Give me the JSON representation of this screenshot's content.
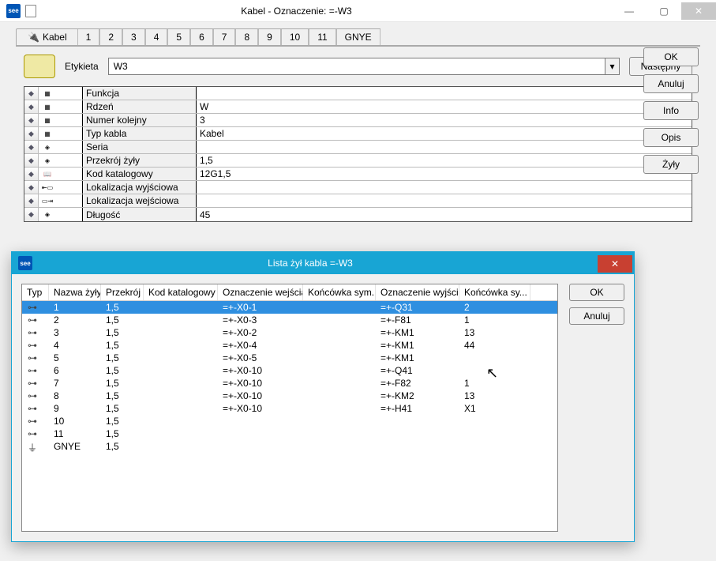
{
  "outer": {
    "title": "Kabel - Oznaczenie: =-W3",
    "tabs": {
      "main": "Kabel",
      "subs": [
        "1",
        "2",
        "3",
        "4",
        "5",
        "6",
        "7",
        "8",
        "9",
        "10",
        "11",
        "GNYE"
      ]
    },
    "etykieta_label": "Etykieta",
    "etykieta_value": "W3",
    "nastepny": "Następny",
    "buttons": {
      "ok": "OK",
      "anuluj": "Anuluj",
      "info": "Info",
      "opis": "Opis",
      "zyly": "Żyły"
    },
    "props": [
      {
        "icon": "chip",
        "label": "Funkcja",
        "value": ""
      },
      {
        "icon": "chip",
        "label": "Rdzeń",
        "value": "W"
      },
      {
        "icon": "chip",
        "label": "Numer kolejny",
        "value": "3"
      },
      {
        "icon": "chip",
        "label": "Typ kabla",
        "value": "Kabel"
      },
      {
        "icon": "dot",
        "label": "Seria",
        "value": ""
      },
      {
        "icon": "dot",
        "label": "Przekrój żyły",
        "value": "1,5"
      },
      {
        "icon": "book",
        "label": "Kod katalogowy",
        "value": "12G1,5"
      },
      {
        "icon": "locL",
        "label": "Lokalizacja wyjściowa",
        "value": ""
      },
      {
        "icon": "locR",
        "label": "Lokalizacja wejściowa",
        "value": ""
      },
      {
        "icon": "dot",
        "label": "Długość",
        "value": "45"
      }
    ]
  },
  "inner": {
    "title": "Lista żył kabla =-W3",
    "buttons": {
      "ok": "OK",
      "anuluj": "Anuluj"
    },
    "headers": [
      "Typ",
      "Nazwa żyły",
      "Przekrój",
      "Kod katalogowy",
      "Oznaczenie wejścia",
      "Końcówka sym...",
      "Oznaczenie wyjścia",
      "Końcówka sy..."
    ],
    "rows": [
      {
        "type": "wire",
        "nazwa": "1",
        "przek": "1,5",
        "kod": "",
        "owe": "=+-X0-1",
        "ks1": "",
        "owy": "=+-Q31",
        "ks2": "2",
        "selected": true
      },
      {
        "type": "wire",
        "nazwa": "2",
        "przek": "1,5",
        "kod": "",
        "owe": "=+-X0-3",
        "ks1": "",
        "owy": "=+-F81",
        "ks2": "1"
      },
      {
        "type": "wire",
        "nazwa": "3",
        "przek": "1,5",
        "kod": "",
        "owe": "=+-X0-2",
        "ks1": "",
        "owy": "=+-KM1",
        "ks2": "13"
      },
      {
        "type": "wire",
        "nazwa": "4",
        "przek": "1,5",
        "kod": "",
        "owe": "=+-X0-4",
        "ks1": "",
        "owy": "=+-KM1",
        "ks2": "44"
      },
      {
        "type": "wire",
        "nazwa": "5",
        "przek": "1,5",
        "kod": "",
        "owe": "=+-X0-5",
        "ks1": "",
        "owy": "=+-KM1",
        "ks2": ""
      },
      {
        "type": "wire",
        "nazwa": "6",
        "przek": "1,5",
        "kod": "",
        "owe": "=+-X0-10",
        "ks1": "",
        "owy": "=+-Q41",
        "ks2": ""
      },
      {
        "type": "wire",
        "nazwa": "7",
        "przek": "1,5",
        "kod": "",
        "owe": "=+-X0-10",
        "ks1": "",
        "owy": "=+-F82",
        "ks2": "1"
      },
      {
        "type": "wire",
        "nazwa": "8",
        "przek": "1,5",
        "kod": "",
        "owe": "=+-X0-10",
        "ks1": "",
        "owy": "=+-KM2",
        "ks2": "13"
      },
      {
        "type": "wire",
        "nazwa": "9",
        "przek": "1,5",
        "kod": "",
        "owe": "=+-X0-10",
        "ks1": "",
        "owy": "=+-H41",
        "ks2": "X1"
      },
      {
        "type": "wire",
        "nazwa": "10",
        "przek": "1,5",
        "kod": "",
        "owe": "",
        "ks1": "",
        "owy": "",
        "ks2": ""
      },
      {
        "type": "wire",
        "nazwa": "11",
        "przek": "1,5",
        "kod": "",
        "owe": "",
        "ks1": "",
        "owy": "",
        "ks2": ""
      },
      {
        "type": "gnd",
        "nazwa": "GNYE",
        "przek": "1,5",
        "kod": "",
        "owe": "",
        "ks1": "",
        "owy": "",
        "ks2": ""
      }
    ]
  }
}
